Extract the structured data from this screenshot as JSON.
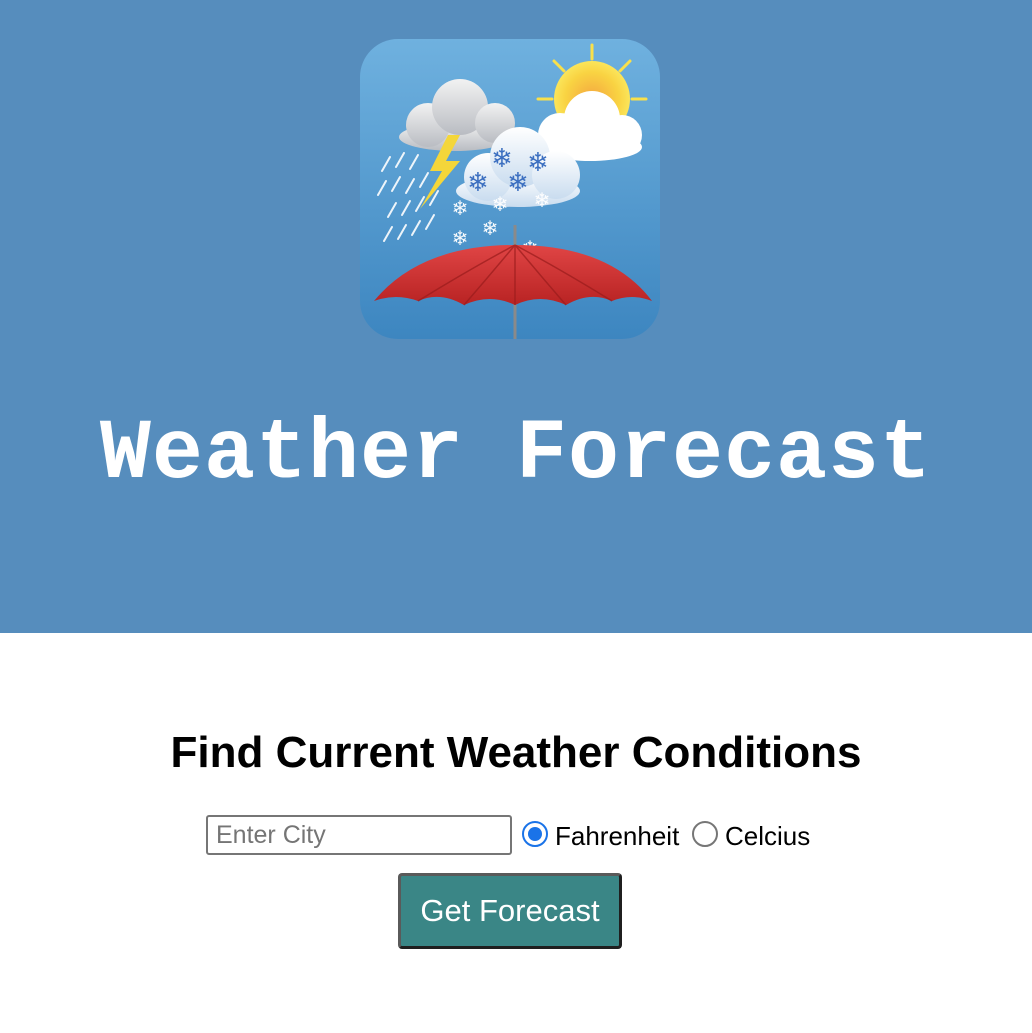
{
  "header": {
    "title": "Weather Forecast",
    "background_color": "#568dbd",
    "app_icon": "weather-umbrella-icon"
  },
  "search": {
    "heading": "Find Current Weather Conditions",
    "city_placeholder": "Enter City",
    "city_value": "",
    "units": [
      {
        "label": "Fahrenheit",
        "selected": true
      },
      {
        "label": "Celcius",
        "selected": false
      }
    ],
    "button_label": "Get Forecast",
    "button_color": "#3a8686"
  }
}
